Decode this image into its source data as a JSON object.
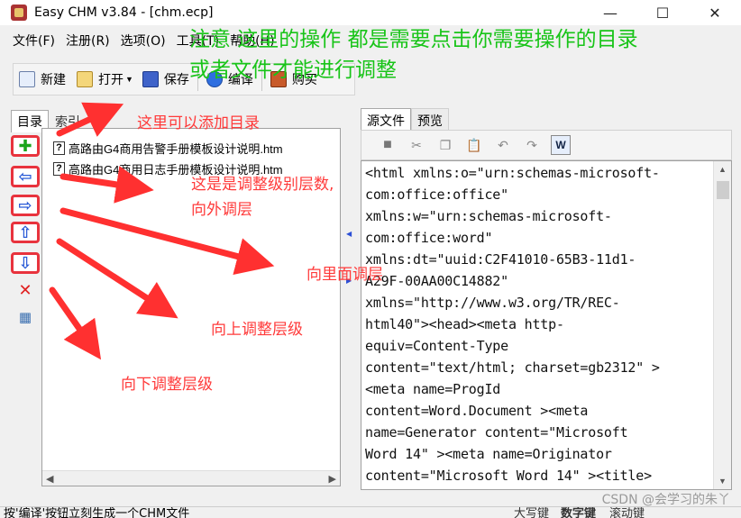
{
  "window": {
    "title": "Easy CHM v3.84 - [chm.ecp]",
    "controls": {
      "minimize": "—",
      "maximize": "☐",
      "close": "✕"
    }
  },
  "menu": [
    {
      "label": "文件(F)"
    },
    {
      "label": "注册(R)"
    },
    {
      "label": "选项(O)"
    },
    {
      "label": "工具(T)"
    },
    {
      "label": "帮助(H)"
    }
  ],
  "toolbar": {
    "new_label": "新建",
    "open_label": "打开",
    "save_label": "保存",
    "compile_label": "编译",
    "buy_label": "购买"
  },
  "left_panel": {
    "tabs": [
      {
        "label": "目录"
      },
      {
        "label": "索引"
      }
    ],
    "tree_items": [
      {
        "label": "高路由G4商用告警手册模板设计说明.htm"
      },
      {
        "label": "高路由G4商用日志手册模板设计说明.htm"
      }
    ],
    "side_tools": [
      {
        "name": "add-topic",
        "glyph": "✚",
        "color": "#1aa51a"
      },
      {
        "name": "outdent",
        "glyph": "⇦",
        "color": "#2a5bd7"
      },
      {
        "name": "indent",
        "glyph": "⇨",
        "color": "#2a5bd7"
      },
      {
        "name": "move-up",
        "glyph": "⇧",
        "color": "#2a5bd7"
      },
      {
        "name": "move-down",
        "glyph": "⇩",
        "color": "#2a5bd7"
      },
      {
        "name": "delete",
        "glyph": "✕",
        "color": "#e02020"
      },
      {
        "name": "properties",
        "glyph": "▦",
        "color": "#3a6fb0"
      }
    ]
  },
  "right_panel": {
    "tabs": [
      {
        "label": "源文件"
      },
      {
        "label": "预览"
      }
    ],
    "code_lines": [
      "<html xmlns:o=\"urn:schemas-microsoft-",
      "com:office:office\"",
      "xmlns:w=\"urn:schemas-microsoft-",
      "com:office:word\"",
      "xmlns:dt=\"uuid:C2F41010-65B3-11d1-",
      "A29F-00AA00C14882\"",
      "xmlns=\"http://www.w3.org/TR/REC-",
      "html40\"><head><meta http-",
      "equiv=Content-Type",
      "content=\"text/html; charset=gb2312\" >",
      "<meta name=ProgId",
      "content=Word.Document ><meta",
      "name=Generator  content=\"Microsoft",
      "Word 14\" ><meta name=Originator",
      "content=\"Microsoft Word 14\" ><title>"
    ]
  },
  "status": {
    "left": "按'编译'按钮立刻生成一个CHM文件",
    "caps": "大写键",
    "num": "数字键",
    "scroll": "滚动键"
  },
  "annotations": {
    "green_line1": "注意 这里的操作 都是需要点击你需要操作的目录",
    "green_line2": "或者文件才能进行调整",
    "add_dir": "这里可以添加目录",
    "adjust_level": "这是是调整级别层数,",
    "outdent": "向外调层",
    "indent": "向里面调层",
    "up": "向上调整层级",
    "down": "向下调整层级"
  },
  "watermark": "CSDN @会学习的朱丫"
}
